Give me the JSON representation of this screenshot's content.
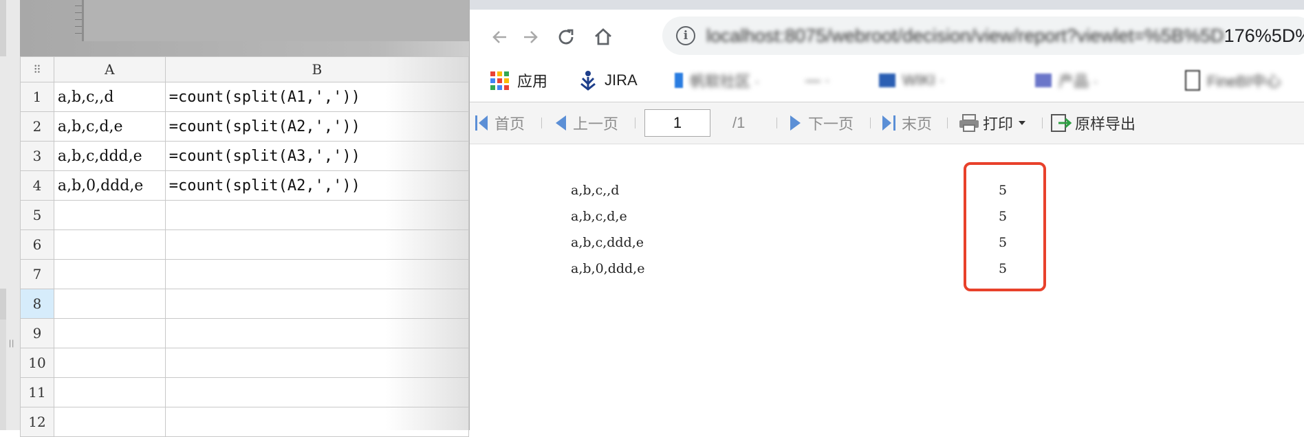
{
  "spreadsheet": {
    "columns": [
      "A",
      "B"
    ],
    "rows": [
      {
        "num": "1",
        "a": "a,b,c,,d",
        "b": "=count(split(A1,','))"
      },
      {
        "num": "2",
        "a": "a,b,c,d,e",
        "b": "=count(split(A2,','))"
      },
      {
        "num": "3",
        "a": "a,b,c,ddd,e",
        "b": "=count(split(A3,','))"
      },
      {
        "num": "4",
        "a": "a,b,0,ddd,e",
        "b": "=count(split(A2,','))"
      },
      {
        "num": "5",
        "a": "",
        "b": ""
      },
      {
        "num": "6",
        "a": "",
        "b": ""
      },
      {
        "num": "7",
        "a": "",
        "b": ""
      },
      {
        "num": "8",
        "a": "",
        "b": ""
      },
      {
        "num": "9",
        "a": "",
        "b": ""
      },
      {
        "num": "10",
        "a": "",
        "b": ""
      },
      {
        "num": "11",
        "a": "",
        "b": ""
      },
      {
        "num": "12",
        "a": "",
        "b": ""
      }
    ],
    "selected_row": "8",
    "corner_glyph": "⠿"
  },
  "browser": {
    "url_visible_tail": "176%5D%",
    "url_obscured": "localhost:8075/webroot/decision/view/report?viewlet=%5B%5D",
    "bookmarks": {
      "apps_label": "应用",
      "jira_label": "JIRA",
      "blurred_labels": [
        "帆软社区 ·",
        "— ·",
        "WIKI ·",
        "产品 ·",
        "FineBI中心"
      ]
    }
  },
  "report_toolbar": {
    "first": "首页",
    "prev": "上一页",
    "page_value": "1",
    "page_total": "/1",
    "next": "下一页",
    "last": "末页",
    "print": "打印",
    "export": "原样导出"
  },
  "report": {
    "rows": [
      {
        "text": "a,b,c,,d",
        "count": "5"
      },
      {
        "text": "a,b,c,d,e",
        "count": "5"
      },
      {
        "text": "a,b,c,ddd,e",
        "count": "5"
      },
      {
        "text": "a,b,0,ddd,e",
        "count": "5"
      }
    ]
  },
  "colors": {
    "highlight": "#e8412b",
    "selected_row_header": "#d6ecfb"
  }
}
